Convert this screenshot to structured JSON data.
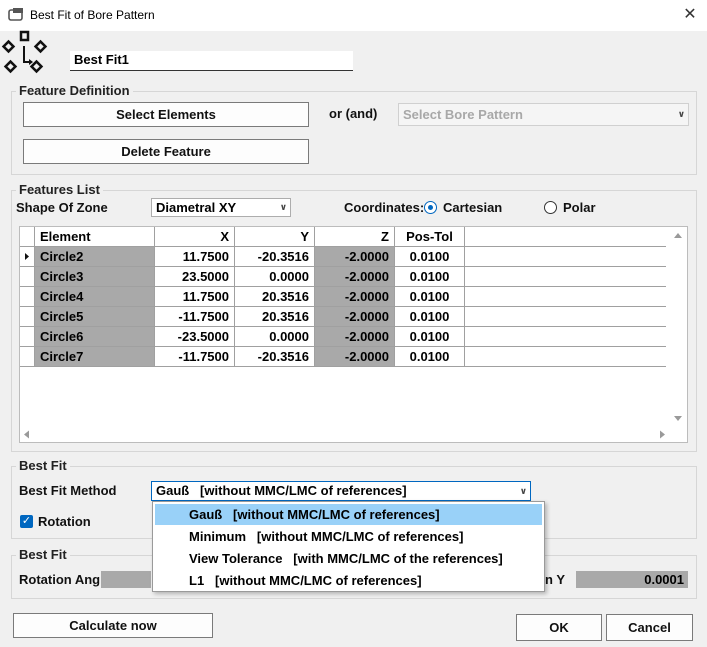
{
  "window": {
    "title": "Best Fit of Bore Pattern",
    "close_glyph": "✕"
  },
  "name_field": {
    "value": "Best Fit1"
  },
  "feature_definition": {
    "label": "Feature Definition",
    "select_elements": "Select Elements",
    "or_and": "or (and)",
    "select_bore_pattern": "Select Bore Pattern",
    "delete_feature": "Delete Feature"
  },
  "features_list": {
    "label": "Features List",
    "shape_of_zone_label": "Shape Of Zone",
    "shape_of_zone_value": "Diametral XY",
    "coordinates_label": "Coordinates:",
    "cartesian": "Cartesian",
    "polar": "Polar",
    "columns": [
      "Element",
      "X",
      "Y",
      "Z",
      "Pos-Tol"
    ],
    "rows": [
      [
        "Circle2",
        "11.7500",
        "-20.3516",
        "-2.0000",
        "0.0100"
      ],
      [
        "Circle3",
        "23.5000",
        "0.0000",
        "-2.0000",
        "0.0100"
      ],
      [
        "Circle4",
        "11.7500",
        "20.3516",
        "-2.0000",
        "0.0100"
      ],
      [
        "Circle5",
        "-11.7500",
        "20.3516",
        "-2.0000",
        "0.0100"
      ],
      [
        "Circle6",
        "-23.5000",
        "0.0000",
        "-2.0000",
        "0.0100"
      ],
      [
        "Circle7",
        "-11.7500",
        "-20.3516",
        "-2.0000",
        "0.0100"
      ]
    ]
  },
  "best_fit": {
    "label": "Best Fit",
    "method_label": "Best Fit Method",
    "method_value": "Gauß   [without MMC/LMC of references]",
    "rotation_label": "Rotation",
    "options": [
      "Gauß   [without MMC/LMC of references]",
      "Minimum   [without MMC/LMC of references]",
      "View Tolerance   [with MMC/LMC of the references]",
      "L1   [without MMC/LMC of references]"
    ]
  },
  "best_fit_result": {
    "label": "Best Fit",
    "rotation_angle_label": "Rotation Ang",
    "shift_y_label": "n Y",
    "shift_y_value": "0.0001"
  },
  "footer": {
    "calculate": "Calculate now",
    "ok": "OK",
    "cancel": "Cancel"
  }
}
